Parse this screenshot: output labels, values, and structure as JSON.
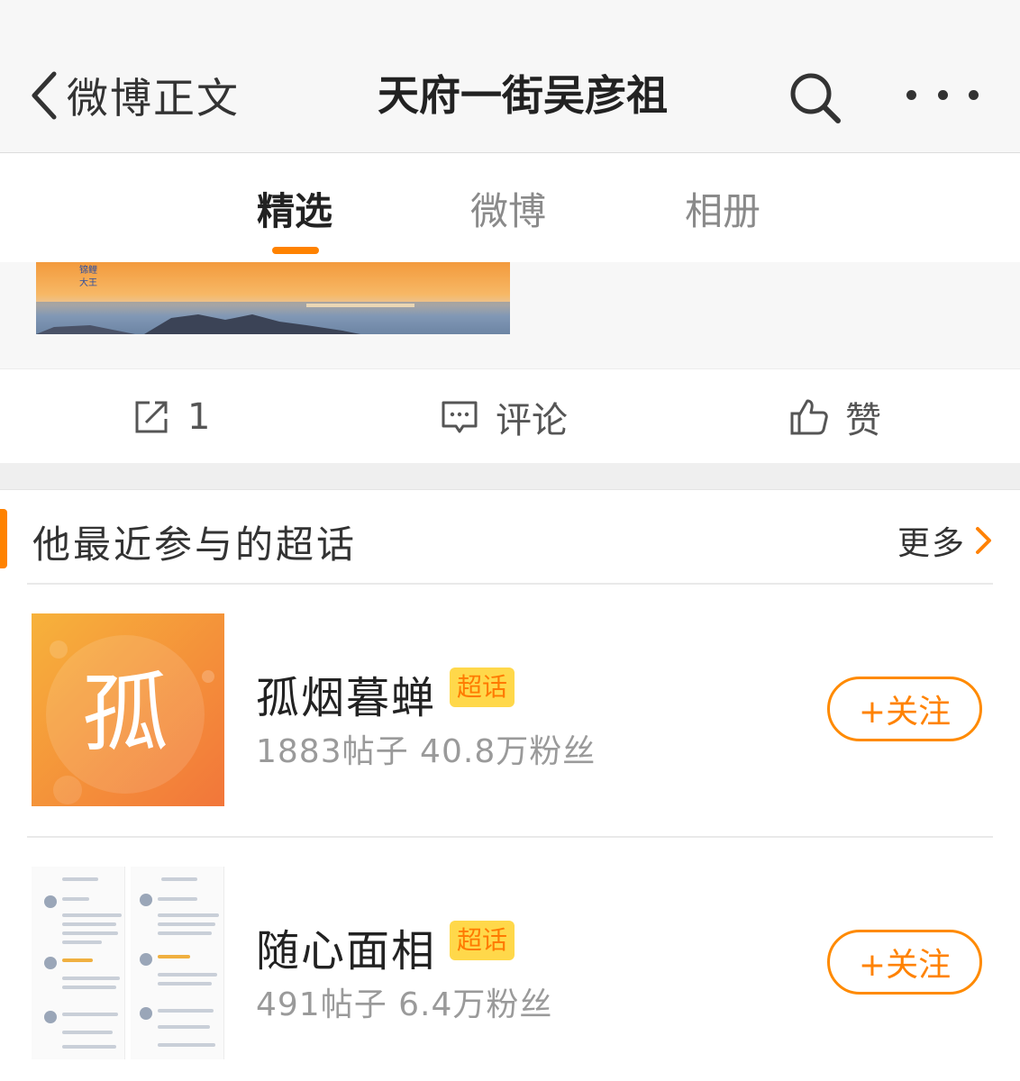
{
  "nav": {
    "back_label": "微博正文",
    "title": "天府一街吴彦祖"
  },
  "tabs": [
    {
      "label": "精选",
      "active": true
    },
    {
      "label": "微博",
      "active": false
    },
    {
      "label": "相册",
      "active": false
    }
  ],
  "post_image": {
    "overlay_text_1": "锦鲤",
    "overlay_text_2": "大王"
  },
  "actions": {
    "repost_count": "1",
    "comment_label": "评论",
    "like_label": "赞"
  },
  "section": {
    "title": "他最近参与的超话",
    "more_label": "更多"
  },
  "supertopics": [
    {
      "name": "孤烟暮蝉",
      "badge": "超话",
      "stats": "1883帖子 40.8万粉丝",
      "thumb_char": "孤",
      "follow_label": "+关注"
    },
    {
      "name": "随心面相",
      "badge": "超话",
      "stats": "491帖子 6.4万粉丝",
      "follow_label": "+关注"
    }
  ],
  "colors": {
    "accent": "#ff8200",
    "badge_bg": "#ffd84a"
  }
}
